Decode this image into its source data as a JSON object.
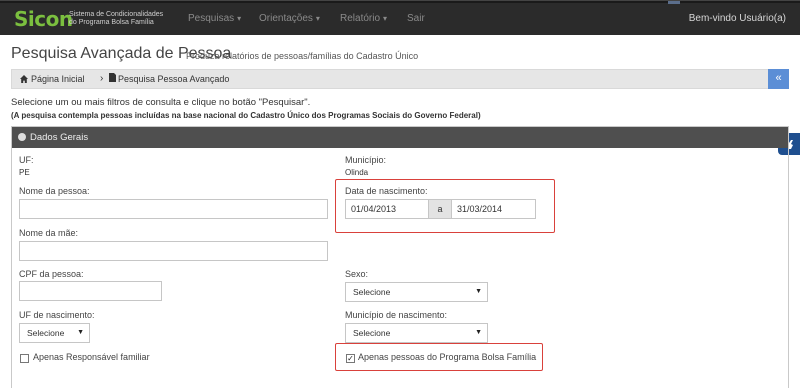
{
  "app": {
    "logo": "Sicon",
    "subtitle_line1": "Sistema de Condicionalidades",
    "subtitle_line2": "do Programa Bolsa Família"
  },
  "nav": {
    "items": [
      {
        "label": "Pesquisas",
        "dropdown": true
      },
      {
        "label": "Orientações",
        "dropdown": true
      },
      {
        "label": "Relatório",
        "dropdown": true
      },
      {
        "label": "Sair",
        "dropdown": false
      }
    ],
    "welcome": "Bem-vindo Usuário(a)"
  },
  "page": {
    "title": "Pesquisa Avançada de Pessoa",
    "subtitle": "Produza relatórios de pessoas/famílias do Cadastro Único"
  },
  "breadcrumb": {
    "home": "Página Inicial",
    "current": "Pesquisa Pessoa Avançado",
    "toggle": "«"
  },
  "instructions": {
    "main": "Selecione um ou mais filtros de consulta e clique no botão \"Pesquisar\".",
    "note": "(A pesquisa contempla pessoas incluídas na base nacional do Cadastro Único dos Programas Sociais do Governo Federal)"
  },
  "panel": {
    "title": "Dados Gerais",
    "uf_label": "UF:",
    "uf_value": "PE",
    "municipio_label": "Município:",
    "municipio_value": "Olinda",
    "nome_pessoa_label": "Nome da pessoa:",
    "data_nasc_label": "Data de nascimento:",
    "data_inicio": "01/04/2013",
    "data_sep": "a",
    "data_fim": "31/03/2014",
    "nome_mae_label": "Nome da mãe:",
    "cpf_label": "CPF da pessoa:",
    "sexo_label": "Sexo:",
    "sexo_value": "Selecione",
    "uf_nasc_label": "UF de nascimento:",
    "uf_nasc_value": "Selecione",
    "mun_nasc_label": "Município de nascimento:",
    "mun_nasc_value": "Selecione",
    "resp_familiar_label": "Apenas Responsável familiar",
    "resp_familiar_checked": false,
    "bolsa_label": "Apenas pessoas do Programa Bolsa Família",
    "bolsa_checked": true
  },
  "colors": {
    "topbar": "#2b2b2b",
    "logo": "#7bbf3f",
    "panel_header": "#4f4f4f",
    "highlight": "#d9413b",
    "breadcrumb_toggle": "#5b8ed6",
    "accessibility": "#1f4f8f"
  },
  "icons": {
    "home": "home-icon",
    "document": "document-icon",
    "panel": "circle-chevron-icon",
    "accessibility": "sign-language-icon"
  }
}
